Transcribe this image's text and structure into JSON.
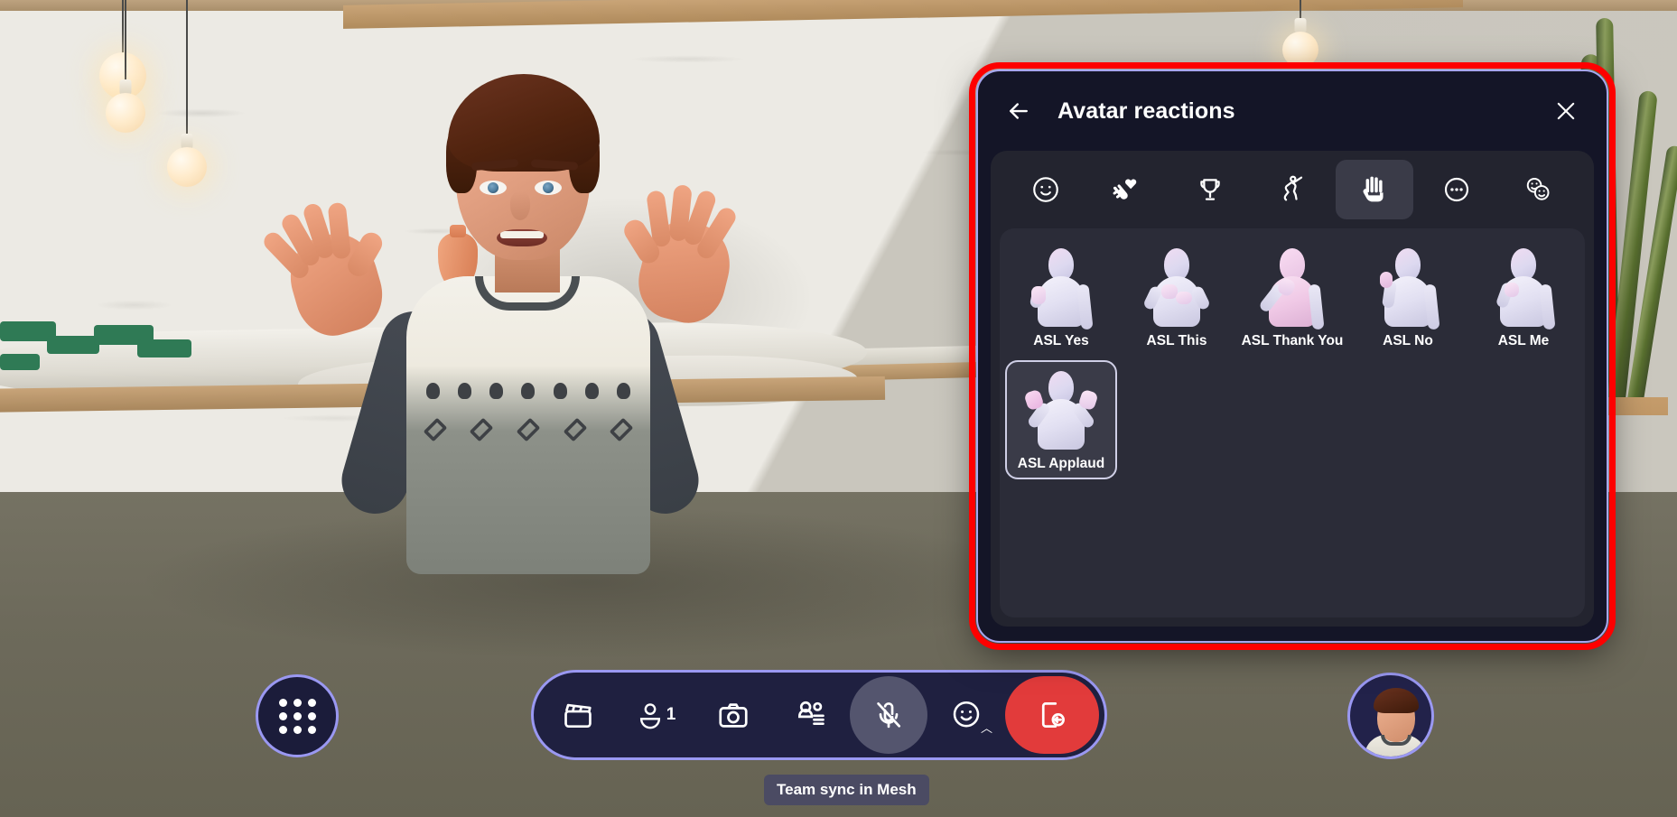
{
  "scene": {
    "description": "virtual-meeting-3d-room",
    "self_avatar_name": "self-avatar-thumbnail"
  },
  "panel": {
    "title": "Avatar reactions",
    "back_icon": "arrow-left-icon",
    "close_icon": "close-icon",
    "highlight_color": "#fe0000",
    "border_color": "#a7a6f0",
    "background_color": "#141527",
    "tabs": [
      {
        "id": "emoji",
        "icon": "smiley-face-icon",
        "selected": false
      },
      {
        "id": "applause",
        "icon": "hand-heart-icon",
        "selected": false
      },
      {
        "id": "celebrate",
        "icon": "trophy-icon",
        "selected": false
      },
      {
        "id": "dance",
        "icon": "dancing-person-icon",
        "selected": false
      },
      {
        "id": "asl",
        "icon": "raised-hand-icon",
        "selected": true
      },
      {
        "id": "more",
        "icon": "ellipsis-circle-icon",
        "selected": false
      },
      {
        "id": "custom",
        "icon": "double-smiley-icon",
        "selected": false
      }
    ],
    "reactions": [
      {
        "label": "ASL Yes",
        "icon": "avatar-asl-yes-figure",
        "focused": false,
        "tone": "light"
      },
      {
        "label": "ASL This",
        "icon": "avatar-asl-this-figure",
        "focused": false,
        "tone": "light"
      },
      {
        "label": "ASL Thank You",
        "icon": "avatar-asl-thankyou-figure",
        "focused": false,
        "tone": "pink"
      },
      {
        "label": "ASL No",
        "icon": "avatar-asl-no-figure",
        "focused": false,
        "tone": "light"
      },
      {
        "label": "ASL Me",
        "icon": "avatar-asl-me-figure",
        "focused": false,
        "tone": "light"
      },
      {
        "label": "ASL Applaud",
        "icon": "avatar-asl-applaud-figure",
        "focused": true,
        "tone": "light"
      }
    ]
  },
  "toolbar": {
    "apps_button": {
      "icon": "grid-dots-icon",
      "label": "Apps"
    },
    "items": [
      {
        "id": "media",
        "icon": "clapperboard-icon",
        "label": "",
        "state": "normal"
      },
      {
        "id": "participants",
        "icon": "person-icon",
        "label": "1",
        "state": "normal"
      },
      {
        "id": "camera",
        "icon": "camera-icon",
        "label": "",
        "state": "normal"
      },
      {
        "id": "chat",
        "icon": "people-chat-icon",
        "label": "",
        "state": "normal"
      },
      {
        "id": "mic",
        "icon": "microphone-muted-icon",
        "label": "",
        "state": "active"
      },
      {
        "id": "reactions",
        "icon": "smiley-caret-icon",
        "label": "",
        "state": "normal"
      },
      {
        "id": "leave",
        "icon": "leave-door-icon",
        "label": "",
        "state": "leave"
      }
    ],
    "leave_color": "#e23b3b",
    "accent_color": "#9a98f2"
  },
  "tooltip": {
    "text": "Team sync in Mesh"
  }
}
